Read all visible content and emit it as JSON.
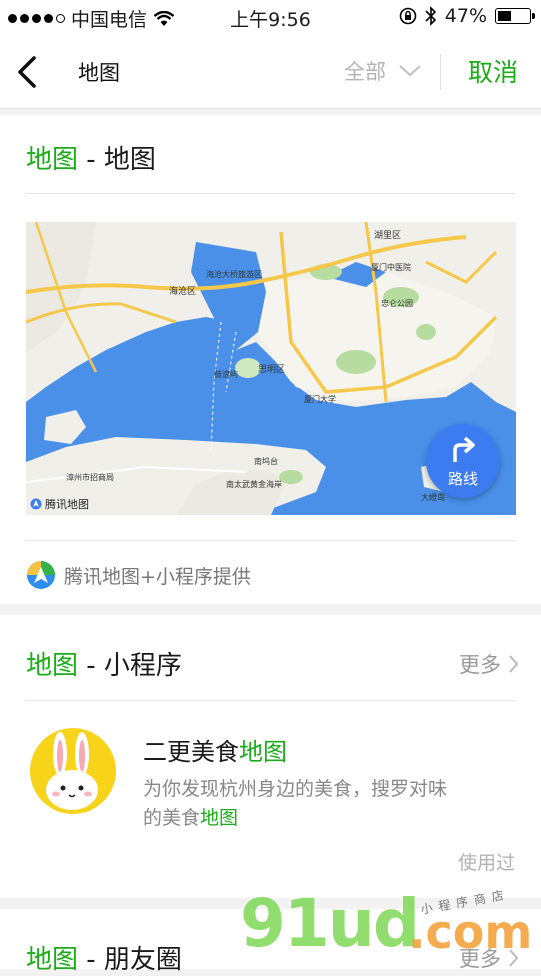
{
  "status_bar": {
    "carrier": "中国电信",
    "time": "上午9:56",
    "battery": "47%",
    "battery_level": 0.47
  },
  "nav": {
    "query": "地图",
    "filter_label": "全部",
    "cancel_label": "取消"
  },
  "map_section": {
    "title_keyword": "地图",
    "title_rest": " - 地图",
    "route_label": "路线",
    "map_brand": "腾讯地图",
    "provider": "腾讯地图+小程序提供",
    "map_labels": {
      "haicang": "海沧区",
      "huli": "湖里区",
      "siming": "思明区",
      "bridge": "海沧大桥旅游区",
      "xiamen_hospital": "厦门中医院",
      "zhongshan_park": "忠仑公园",
      "gulangyu": "鼓浪屿",
      "xiamen_univ": "厦门大学",
      "zhangzhou_port": "漳州市招商局",
      "nantaiwu": "南太武黄金海岸",
      "nanyutai": "南坞台",
      "dadeng": "大嶝岛"
    }
  },
  "miniprogram_section": {
    "title_keyword": "地图",
    "title_rest": " - 小程序",
    "more_label": "更多",
    "app_name_prefix": "二更美食",
    "app_name_keyword": "地图",
    "desc_line1": "为你发现杭州身边的美食，搜罗对味",
    "desc_line2_prefix": "的美食",
    "desc_line2_keyword": "地图",
    "used_label": "使用过"
  },
  "moments_section": {
    "title_keyword": "地图",
    "title_rest": " - 朋友圈",
    "more_label": "更多"
  },
  "watermark": {
    "main": "91ud",
    "dot": ".com",
    "sub": "小程序商店"
  },
  "colors": {
    "accent": "#1aad19",
    "map_sea": "#4a90e8",
    "route_button": "#3d7cf0"
  }
}
